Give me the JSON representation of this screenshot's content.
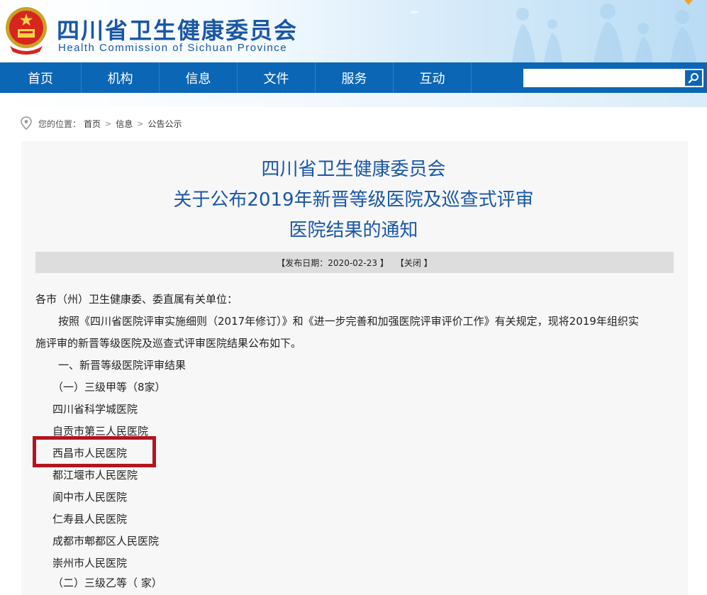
{
  "header": {
    "title_cn": "四川省卫生健康委员会",
    "title_en": "Health Commission of Sichuan Province"
  },
  "nav": {
    "items": [
      "首页",
      "机构",
      "信息",
      "文件",
      "服务",
      "互动"
    ]
  },
  "search": {
    "placeholder": "",
    "value": ""
  },
  "breadcrumb": {
    "prefix": "您的位置：",
    "items": [
      "首页",
      "信息",
      "公告公示"
    ]
  },
  "article": {
    "title_lines": [
      "四川省卫生健康委员会",
      "关于公布2019年新晋等级医院及巡查式评审",
      "医院结果的通知"
    ],
    "meta": {
      "date_label": "【发布日期：2020-02-23 】",
      "close_label": "【关闭 】"
    },
    "salutation": "各市（州）卫生健康委、委直属有关单位：",
    "para1_line1": "按照《四川省医院评审实施细则（2017年修订）》和《进一步完善和加强医院评审评价工作》有关规定，现将2019年组织实",
    "para1_line2": "施评审的新晋等级医院及巡查式评审医院结果公布如下。",
    "section1": "一、新晋等级医院评审结果",
    "subsection1": "（一）三级甲等（8家）",
    "hospitals": [
      "四川省科学城医院",
      "自贡市第三人民医院",
      "西昌市人民医院",
      "都江堰市人民医院",
      "阆中市人民医院",
      "仁寿县人民医院",
      "成都市郫都区人民医院",
      "崇州市人民医院"
    ],
    "cut_line": "（二）三级乙等（ 家）"
  },
  "colors": {
    "nav_bg": "#0c66b6",
    "title_blue": "#1a57a6",
    "highlight_red": "#b3151e",
    "panel_bg": "#f7f7f7"
  }
}
